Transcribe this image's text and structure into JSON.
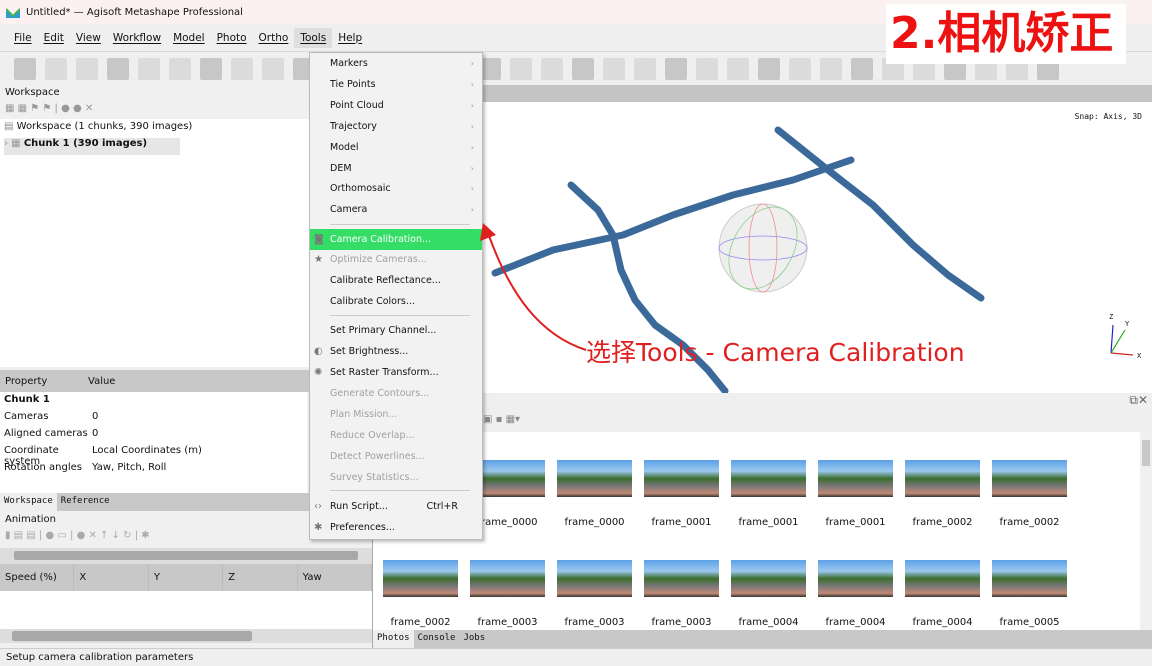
{
  "window": {
    "title": "Untitled* — Agisoft Metashape Professional"
  },
  "menubar": [
    "File",
    "Edit",
    "View",
    "Workflow",
    "Model",
    "Photo",
    "Ortho",
    "Tools",
    "Help"
  ],
  "active_menu": "Tools",
  "workspace": {
    "title": "Workspace",
    "root": "Workspace (1 chunks, 390 images)",
    "chunk": "Chunk 1 (390 images)"
  },
  "properties": {
    "headers": [
      "Property",
      "Value"
    ],
    "section": "Chunk 1",
    "rows": [
      [
        "Cameras",
        "0"
      ],
      [
        "Aligned cameras",
        "0"
      ],
      [
        "Coordinate system",
        "Local Coordinates (m)"
      ],
      [
        "Rotation angles",
        "Yaw, Pitch, Roll"
      ]
    ]
  },
  "left_tabs": [
    "Workspace",
    "Reference"
  ],
  "animation": {
    "title": "Animation",
    "columns": [
      "Speed (%)",
      "X",
      "Y",
      "Z",
      "Yaw"
    ]
  },
  "view": {
    "snap": "Snap: Axis, 3D",
    "axes": [
      "Z",
      "Y",
      "X"
    ],
    "track_color": "#3b6a9a"
  },
  "tools_menu": [
    {
      "label": "Markers",
      "sub": true
    },
    {
      "label": "Tie Points",
      "sub": true
    },
    {
      "label": "Point Cloud",
      "sub": true
    },
    {
      "label": "Trajectory",
      "sub": true
    },
    {
      "label": "Model",
      "sub": true
    },
    {
      "label": "DEM",
      "sub": true
    },
    {
      "label": "Orthomosaic",
      "sub": true
    },
    {
      "label": "Camera",
      "sub": true
    },
    {
      "label": "Camera Calibration...",
      "highlight": true,
      "icon": "camera-icon"
    },
    {
      "label": "Optimize Cameras...",
      "disabled": true,
      "icon": "star-icon"
    },
    {
      "label": "Calibrate Reflectance..."
    },
    {
      "label": "Calibrate Colors..."
    },
    {
      "label": "Set Primary Channel..."
    },
    {
      "label": "Set Brightness...",
      "icon": "brightness-icon"
    },
    {
      "label": "Set Raster Transform...",
      "icon": "palette-icon"
    },
    {
      "label": "Generate Contours...",
      "disabled": true
    },
    {
      "label": "Plan Mission...",
      "disabled": true
    },
    {
      "label": "Reduce Overlap...",
      "disabled": true
    },
    {
      "label": "Detect Powerlines...",
      "disabled": true
    },
    {
      "label": "Survey Statistics...",
      "disabled": true
    },
    {
      "label": "Run Script...",
      "shortcut": "Ctrl+R",
      "icon": "code-icon"
    },
    {
      "label": "Preferences...",
      "icon": "tools-icon"
    }
  ],
  "photos": {
    "row1": [
      "frame_0000",
      "frame_0000",
      "frame_0001",
      "frame_0001",
      "frame_0001",
      "frame_0002",
      "frame_0002"
    ],
    "row2": [
      "frame_0002",
      "frame_0003",
      "frame_0003",
      "frame_0003",
      "frame_0004",
      "frame_0004",
      "frame_0004",
      "frame_0005"
    ]
  },
  "bottom_tabs": [
    "Photos",
    "Console",
    "Jobs"
  ],
  "status": "Setup camera calibration parameters",
  "annotation": {
    "text": "选择Tools - Camera Calibration",
    "step": "2.相机矫正",
    "color": "#e02020"
  },
  "highlight_color": "#33dd66"
}
